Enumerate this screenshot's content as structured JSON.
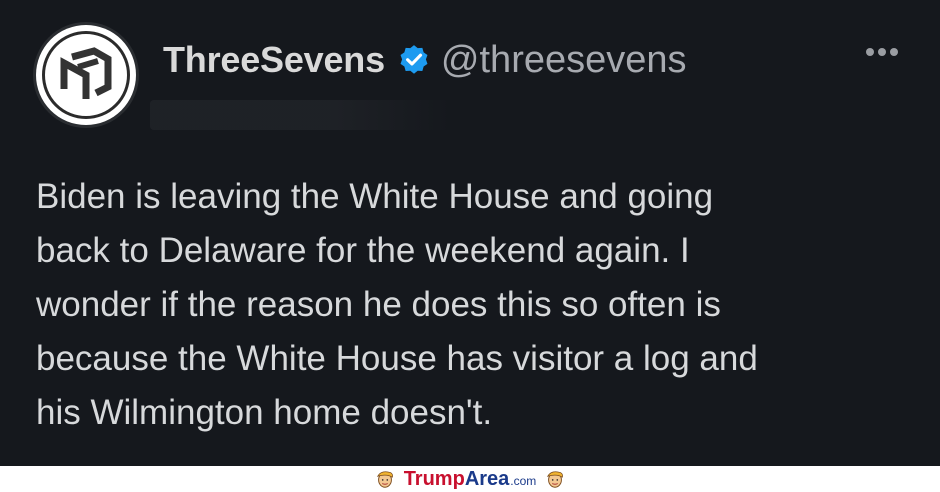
{
  "tweet": {
    "display_name": "ThreeSevens",
    "handle": "@threesevens",
    "text": "Biden is leaving the White House and going\nback to Delaware for the weekend again. I\nwonder if the reason he does this so often is\nbecause the White House has visitor a log and\nhis Wilmington home doesn't.",
    "icons": {
      "avatar": "threesevens-logo-icon",
      "verified": "verified-badge-icon",
      "more": "more-options-icon"
    }
  },
  "footer": {
    "brand_part1": "Trump",
    "brand_part2": "Area",
    "brand_part3": ".com",
    "icons": [
      "trump-face-icon",
      "trump-face-icon"
    ]
  },
  "colors": {
    "background": "#15181d",
    "verified": "#1d9bf0",
    "brand_red": "#c8102e",
    "brand_blue": "#1a3a8a"
  }
}
